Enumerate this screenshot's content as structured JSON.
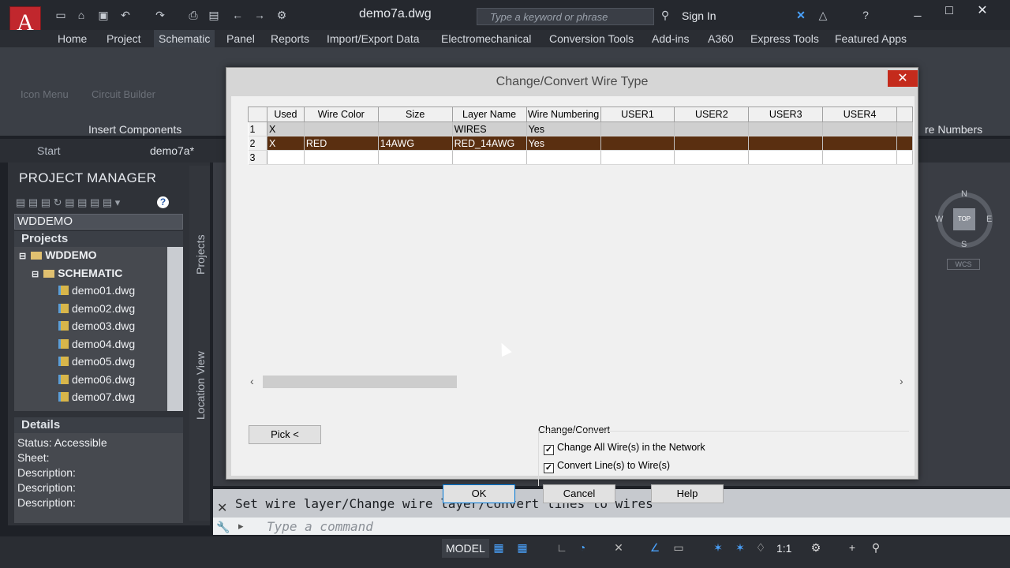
{
  "app": {
    "logo": "A",
    "doc_title": "demo7a.dwg",
    "search_placeholder": "Type a keyword or phrase",
    "signin": "Sign In"
  },
  "menu": {
    "tabs": [
      "Home",
      "Project",
      "Schematic",
      "Panel",
      "Reports",
      "Import/Export Data",
      "Electromechanical",
      "Conversion Tools",
      "Add-ins",
      "A360",
      "Express Tools",
      "Featured Apps"
    ]
  },
  "ribbon": {
    "insert_components": "Insert Components",
    "wire_numbers": "re Numbers",
    "icon_menu": "Icon Menu",
    "circuit_builder": "Circuit Builder"
  },
  "filetabs": {
    "start": "Start",
    "current": "demo7a*"
  },
  "project_manager": {
    "title": "PROJECT MANAGER",
    "selected_project": "WDDEMO",
    "projects_header": "Projects",
    "tree": {
      "root": "WDDEMO",
      "folder": "SCHEMATIC",
      "files": [
        "demo01.dwg",
        "demo02.dwg",
        "demo03.dwg",
        "demo04.dwg",
        "demo05.dwg",
        "demo06.dwg",
        "demo07.dwg"
      ]
    },
    "details_header": "Details",
    "details": [
      "Status: Accessible",
      "Sheet:",
      "Description:",
      "Description:",
      "Description:"
    ],
    "side_tabs": {
      "projects": "Projects",
      "location": "Location View"
    }
  },
  "viewcube": {
    "n": "N",
    "s": "S",
    "e": "E",
    "w": "W",
    "top": "TOP",
    "wcs": "WCS"
  },
  "dialog": {
    "title": "Change/Convert Wire Type",
    "columns": [
      "Used",
      "Wire Color",
      "Size",
      "Layer Name",
      "Wire Numbering",
      "USER1",
      "USER2",
      "USER3",
      "USER4"
    ],
    "rows": [
      {
        "num": "1",
        "used": "X",
        "color": "",
        "size": "",
        "layer": "WIRES",
        "numbering": "Yes"
      },
      {
        "num": "2",
        "used": "X",
        "color": "RED",
        "size": "14AWG",
        "layer": "RED_14AWG",
        "numbering": "Yes"
      },
      {
        "num": "3",
        "used": "",
        "color": "",
        "size": "",
        "layer": "",
        "numbering": ""
      }
    ],
    "pick_button": "Pick <",
    "group_label": "Change/Convert",
    "check_all": "Change All Wire(s) in the Network",
    "check_convert": "Convert Line(s) to Wire(s)",
    "ok": "OK",
    "cancel": "Cancel",
    "help": "Help"
  },
  "command": {
    "history": "Set wire layer/Change wire layer/Convert lines to wires",
    "placeholder": "Type a command"
  },
  "status": {
    "model": "MODEL",
    "scale": "1:1"
  }
}
